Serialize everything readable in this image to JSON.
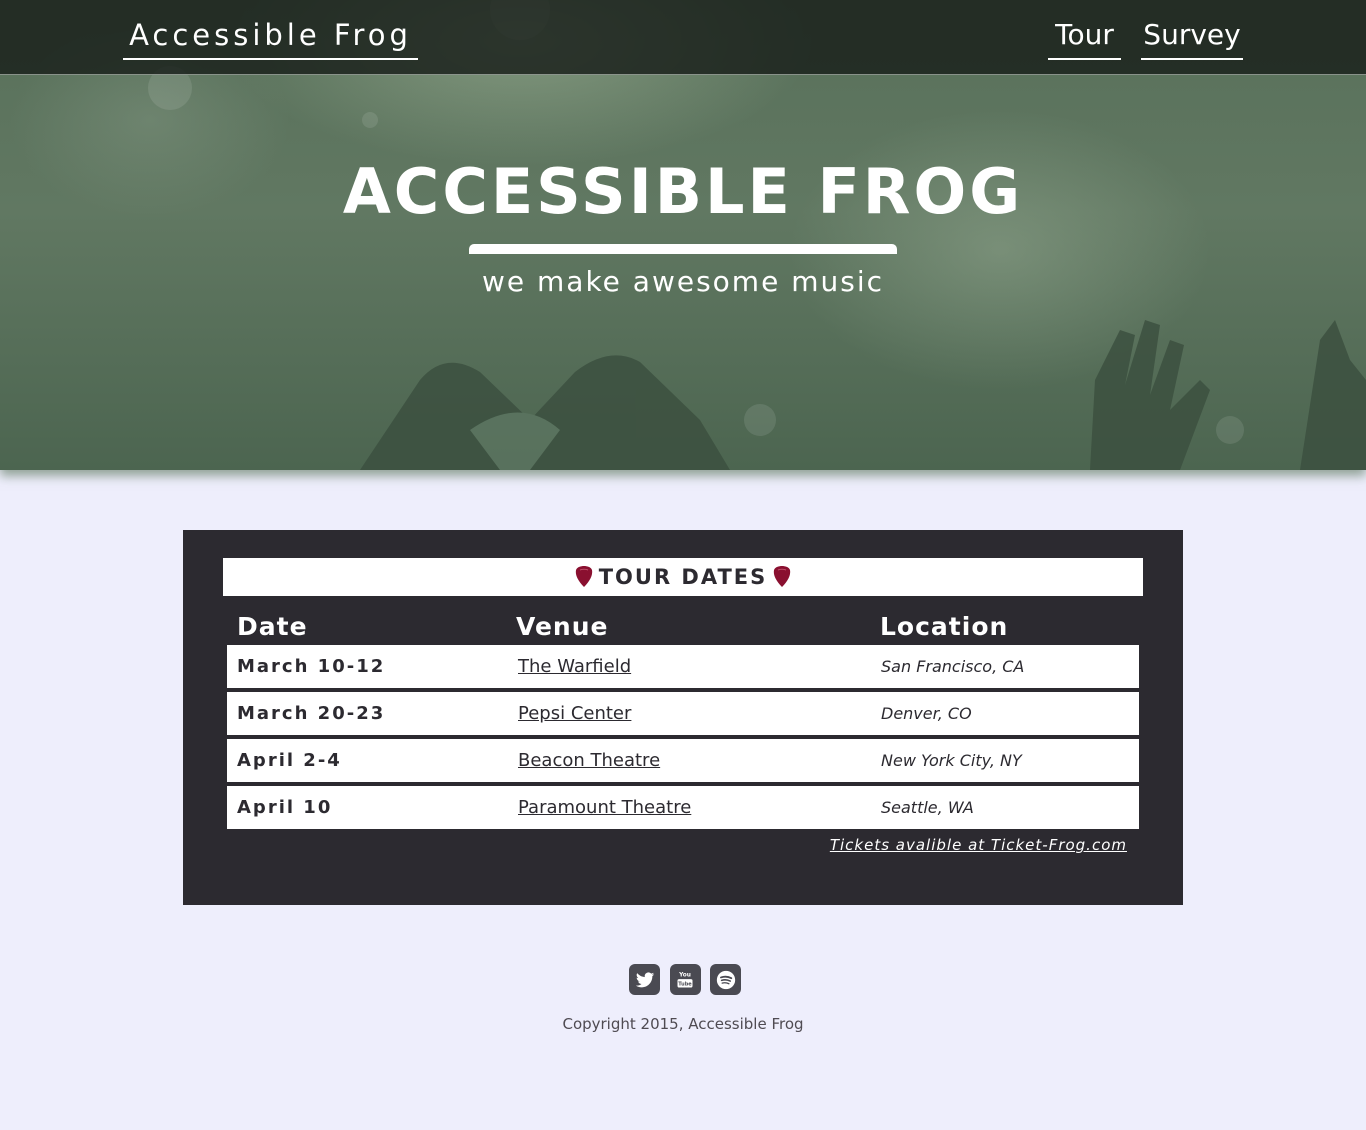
{
  "header": {
    "brand": "Accessible Frog",
    "nav": [
      {
        "label": "Tour"
      },
      {
        "label": "Survey"
      }
    ]
  },
  "hero": {
    "title": "ACCESSIBLE FROG",
    "subtitle": "we make awesome music"
  },
  "tour": {
    "title": "TOUR DATES",
    "columns": [
      "Date",
      "Venue",
      "Location"
    ],
    "rows": [
      {
        "date": "March 10-12",
        "venue": "The Warfield",
        "location": "San Francisco, CA"
      },
      {
        "date": "March 20-23",
        "venue": "Pepsi Center",
        "location": "Denver, CO"
      },
      {
        "date": "April 2-4",
        "venue": "Beacon Theatre",
        "location": "New York City, NY"
      },
      {
        "date": "April 10",
        "venue": "Paramount Theatre",
        "location": "Seattle, WA"
      }
    ],
    "tickets_text": "Tickets avalible at Ticket-Frog.com"
  },
  "footer": {
    "social_icons": [
      "twitter-icon",
      "youtube-icon",
      "spotify-icon"
    ],
    "copyright": "Copyright 2015, Accessible Frog"
  },
  "colors": {
    "page_background": "#eeeefc",
    "panel_background": "#2c2a30",
    "hero_tint": "#58705a",
    "pick_red": "#8a1030",
    "icon_gray": "#4a4a52"
  }
}
